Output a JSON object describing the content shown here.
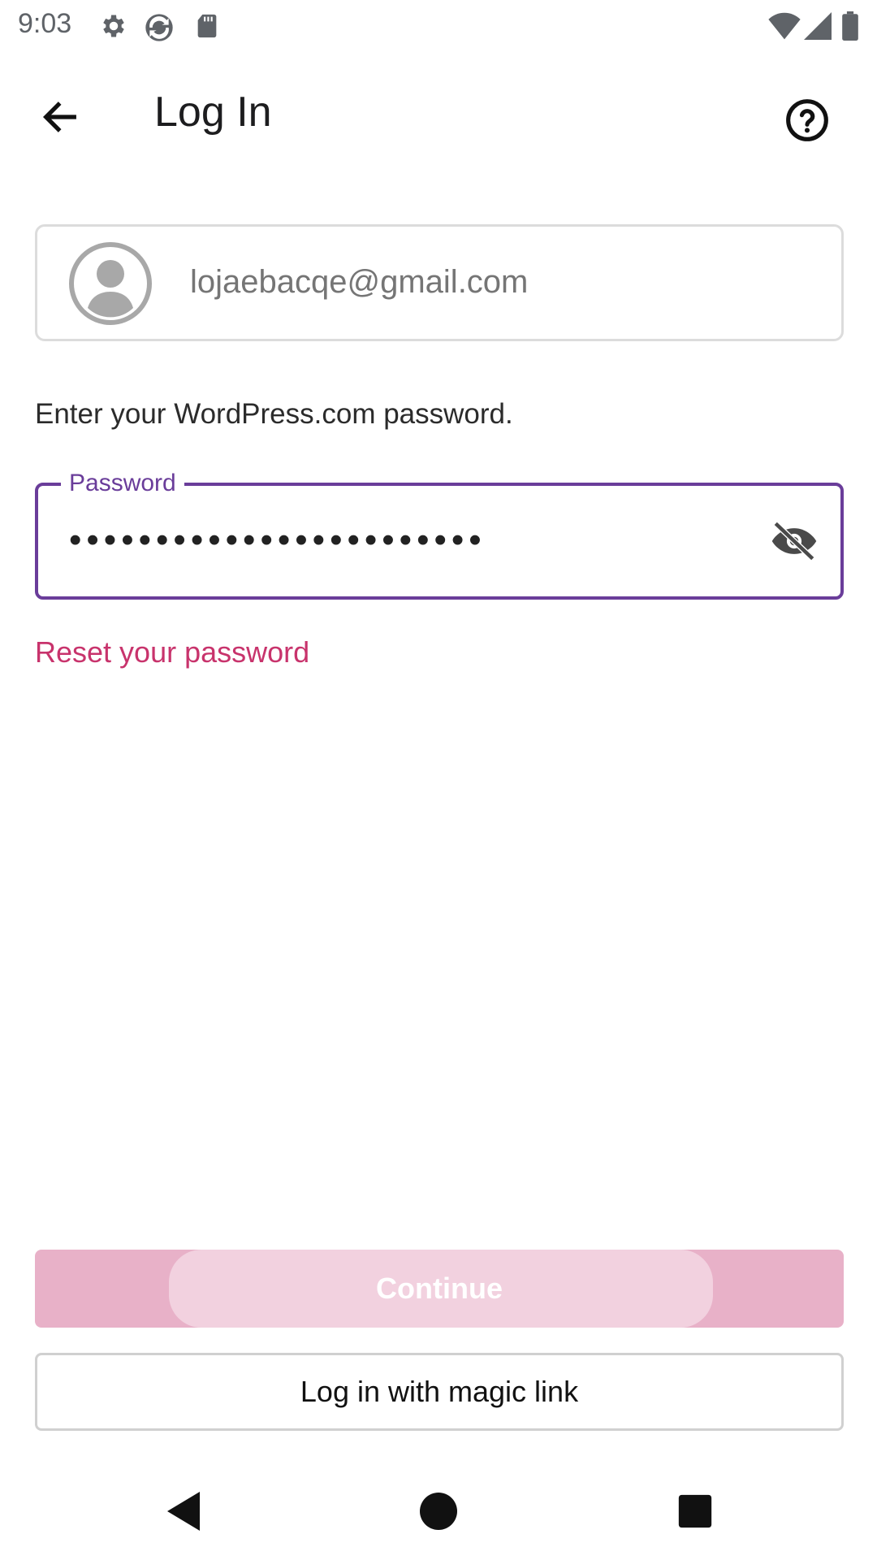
{
  "status_bar": {
    "time": "9:03",
    "icons": [
      "gear-icon",
      "sync-icon",
      "sd-card-icon",
      "wifi-icon",
      "signal-icon",
      "battery-icon"
    ]
  },
  "app_bar": {
    "title": "Log In",
    "back_icon": "arrow-left-icon",
    "help_icon": "help-circle-icon"
  },
  "account": {
    "email": "lojaebacqe@gmail.com",
    "avatar_icon": "account-circle-icon"
  },
  "instruction": "Enter your WordPress.com password.",
  "password": {
    "label": "Password",
    "masked_value": "••••••••••••••••••••••••",
    "visibility_icon": "eye-off-icon"
  },
  "reset_link": "Reset your password",
  "buttons": {
    "continue": "Continue",
    "magic_link": "Log in with magic link"
  },
  "colors": {
    "accent_purple": "#6a3d9a",
    "link_pink": "#c8336c",
    "continue_bg": "#e8b1c8"
  },
  "nav_bar": {
    "icons": [
      "back-triangle-icon",
      "home-circle-icon",
      "recents-square-icon"
    ]
  }
}
